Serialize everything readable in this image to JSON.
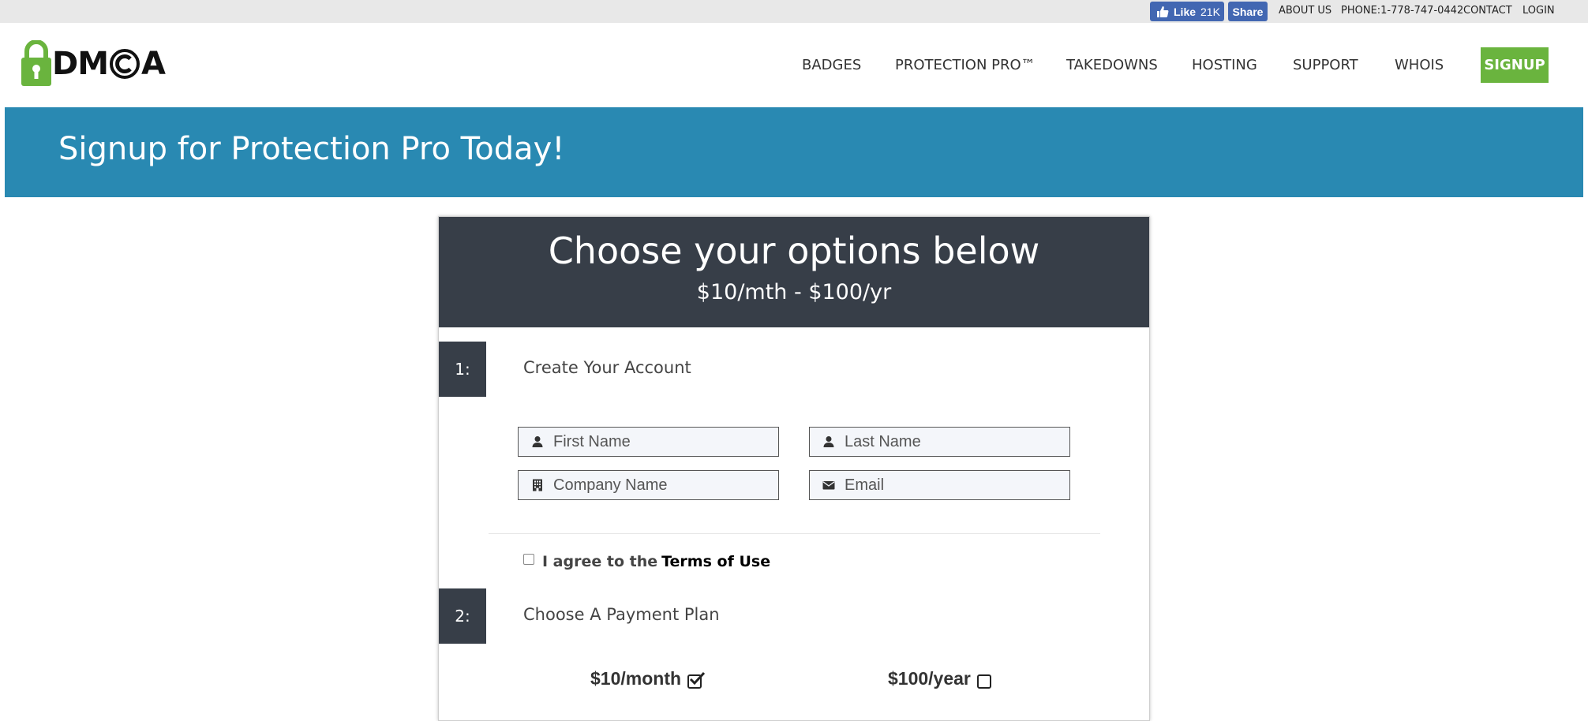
{
  "topbar": {
    "like_label": "Like",
    "like_count": "21K",
    "share_label": "Share",
    "links": [
      "ABOUT US",
      "PHONE:1-778-747-0442",
      "CONTACT",
      "LOGIN"
    ]
  },
  "header": {
    "logo_text_left": "DM",
    "logo_text_right": "A",
    "nav": [
      "BADGES",
      "PROTECTION PRO™",
      "TAKEDOWNS",
      "HOSTING",
      "SUPPORT",
      "WHOIS"
    ],
    "signup_label": "SIGNUP",
    "signup_color": "#6ab43e"
  },
  "hero": {
    "title": "Signup for Protection Pro Today!",
    "background": "#2989b2"
  },
  "card": {
    "title": "Choose your options below",
    "price": "$10/mth - $100/yr",
    "header_color": "#373e48"
  },
  "step1": {
    "number": "1:",
    "label": "Create Your Account",
    "fields": {
      "first_name": {
        "placeholder": "First Name",
        "icon": "user-icon"
      },
      "last_name": {
        "placeholder": "Last Name",
        "icon": "user-icon"
      },
      "company": {
        "placeholder": "Company Name",
        "icon": "building-icon"
      },
      "email": {
        "placeholder": "Email",
        "icon": "envelope-icon"
      }
    },
    "agree_text": "I agree to the",
    "terms_link": "Terms of Use"
  },
  "step2": {
    "number": "2:",
    "label": "Choose A Payment Plan",
    "plans": [
      {
        "price": "$10",
        "period": "/month",
        "checked": true
      },
      {
        "price": "$100",
        "period": "/year",
        "checked": false
      }
    ]
  }
}
